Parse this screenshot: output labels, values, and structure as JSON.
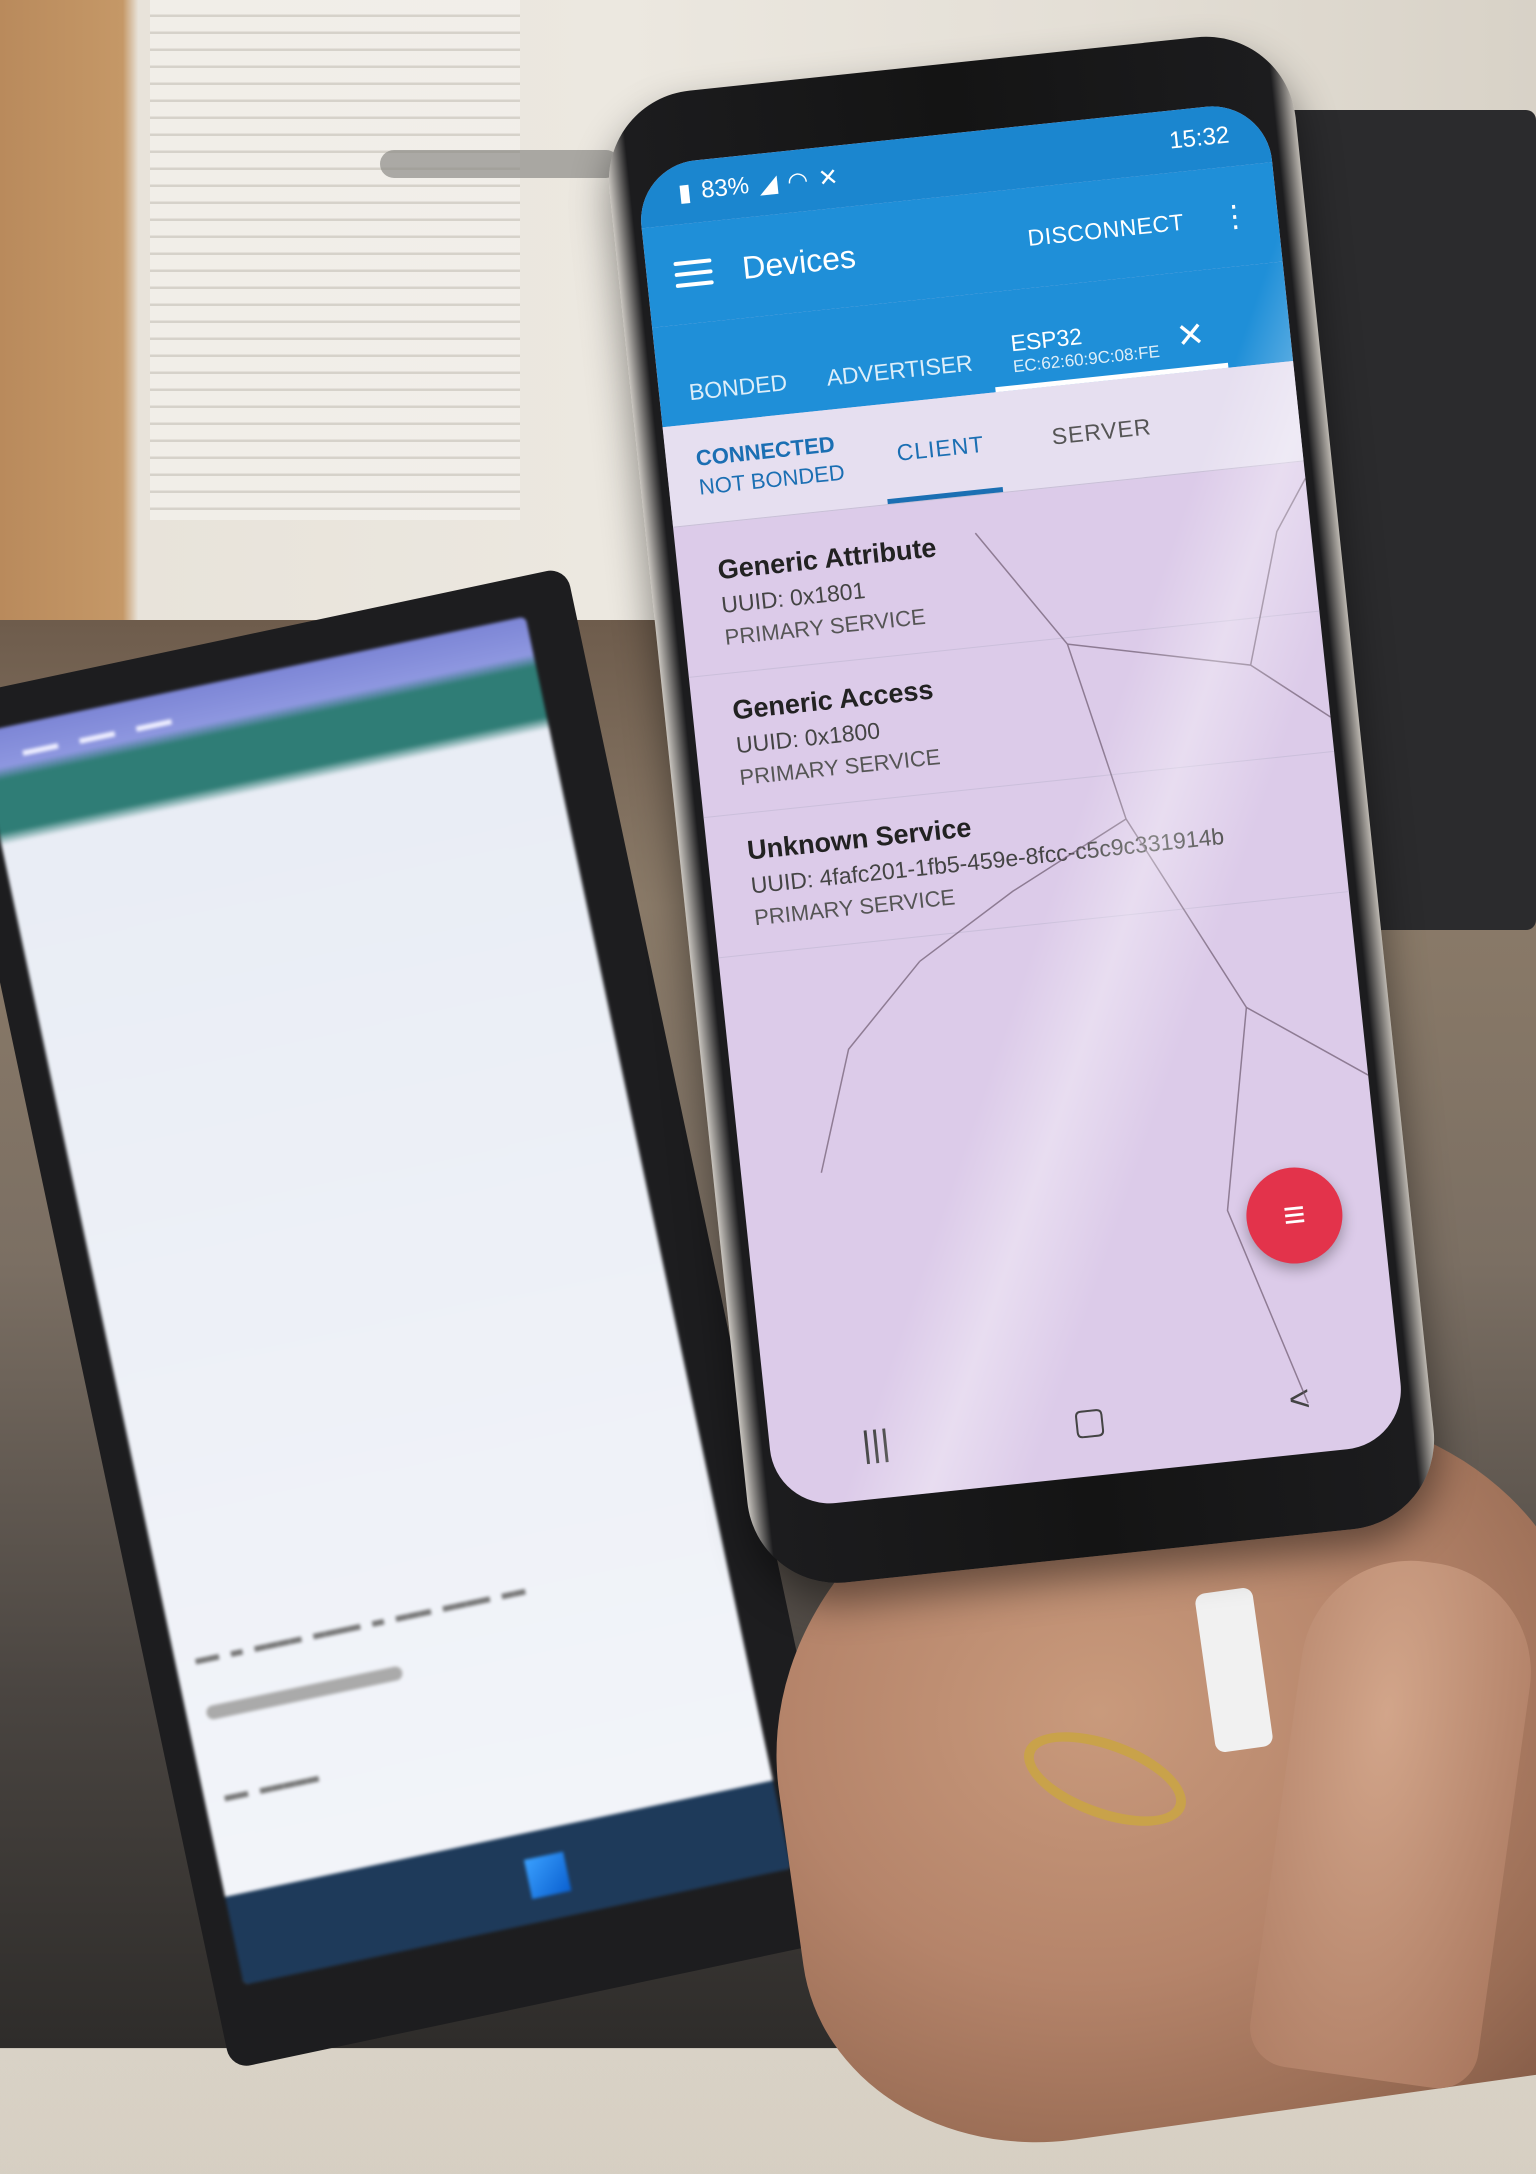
{
  "phone": {
    "status": {
      "battery": "83%",
      "time": "15:32"
    },
    "appbar": {
      "title": "Devices",
      "disconnect_label": "DISCONNECT",
      "overflow_icon": "more-vert-icon"
    },
    "device_tabs": [
      {
        "label": "BONDED"
      },
      {
        "label": "ADVERTISER"
      }
    ],
    "active_device": {
      "name": "ESP32",
      "address": "EC:62:60:9C:08:FE"
    },
    "connection": {
      "state": "CONNECTED",
      "bond": "NOT BONDED"
    },
    "sub_tabs": [
      {
        "label": "CLIENT"
      },
      {
        "label": "SERVER"
      }
    ],
    "services": [
      {
        "name": "Generic Attribute",
        "uuid": "UUID: 0x1801",
        "type": "PRIMARY SERVICE"
      },
      {
        "name": "Generic Access",
        "uuid": "UUID: 0x1800",
        "type": "PRIMARY SERVICE"
      },
      {
        "name": "Unknown Service",
        "uuid": "UUID: 4fafc201-1fb5-459e-8fcc-c5c9c331914b",
        "type": "PRIMARY SERVICE"
      }
    ],
    "colors": {
      "appbar": "#1f8fd8",
      "accent": "#1b6fb3",
      "fab": "#e3334b",
      "screen_bg": "#dccbe9"
    }
  }
}
